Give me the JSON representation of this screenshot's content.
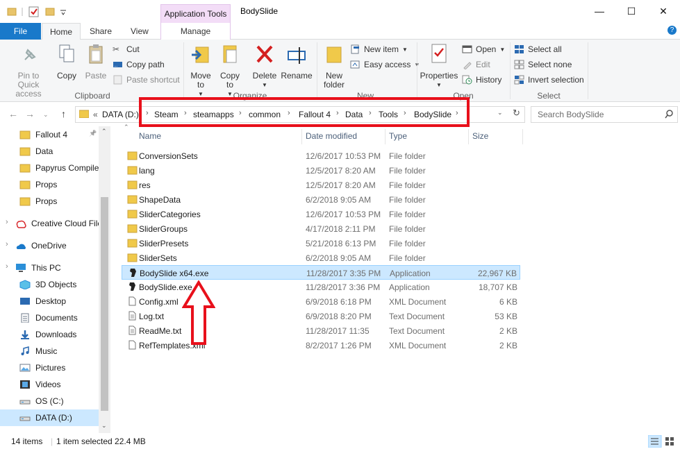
{
  "window": {
    "title": "BodySlide",
    "context_tab": "Application Tools",
    "minimize": "—",
    "maximize": "☐",
    "close": "✕"
  },
  "tabs": {
    "file": "File",
    "home": "Home",
    "share": "Share",
    "view": "View",
    "manage": "Manage"
  },
  "ribbon": {
    "clipboard": {
      "label": "Clipboard",
      "pin": "Pin to Quick access",
      "copy": "Copy",
      "paste": "Paste",
      "cut": "Cut",
      "copy_path": "Copy path",
      "paste_shortcut": "Paste shortcut"
    },
    "organize": {
      "label": "Organize",
      "move_to": "Move to",
      "copy_to": "Copy to",
      "delete": "Delete",
      "rename": "Rename"
    },
    "new": {
      "label": "New",
      "new_folder": "New folder",
      "new_item": "New item",
      "easy_access": "Easy access"
    },
    "open": {
      "label": "Open",
      "properties": "Properties",
      "open": "Open",
      "edit": "Edit",
      "history": "History"
    },
    "select": {
      "label": "Select",
      "select_all": "Select all",
      "select_none": "Select none",
      "invert": "Invert selection"
    }
  },
  "address": {
    "prefix": "«",
    "crumbs": [
      "DATA (D:)",
      "Steam",
      "steamapps",
      "common",
      "Fallout 4",
      "Data",
      "Tools",
      "BodySlide"
    ]
  },
  "search": {
    "placeholder": "Search BodySlide"
  },
  "nav_pane": {
    "items": [
      {
        "label": "Fallout 4",
        "icon": "folder-icon"
      },
      {
        "label": "Data",
        "icon": "folder-icon"
      },
      {
        "label": "Papyrus Compiler",
        "icon": "folder-icon"
      },
      {
        "label": "Props",
        "icon": "folder-icon"
      },
      {
        "label": "Props",
        "icon": "folder-icon"
      },
      {
        "label": "Creative Cloud Files",
        "icon": "creative-cloud-icon"
      },
      {
        "label": "OneDrive",
        "icon": "onedrive-icon"
      },
      {
        "label": "This PC",
        "icon": "computer-icon"
      },
      {
        "label": "3D Objects",
        "icon": "cube-icon"
      },
      {
        "label": "Desktop",
        "icon": "desktop-icon"
      },
      {
        "label": "Documents",
        "icon": "documents-icon"
      },
      {
        "label": "Downloads",
        "icon": "download-icon"
      },
      {
        "label": "Music",
        "icon": "music-icon"
      },
      {
        "label": "Pictures",
        "icon": "pictures-icon"
      },
      {
        "label": "Videos",
        "icon": "videos-icon"
      },
      {
        "label": "OS (C:)",
        "icon": "drive-icon"
      },
      {
        "label": "DATA (D:)",
        "icon": "drive-icon"
      }
    ]
  },
  "columns": {
    "name": "Name",
    "date": "Date modified",
    "type": "Type",
    "size": "Size"
  },
  "files": [
    {
      "name": "ConversionSets",
      "date": "12/6/2017 10:53 PM",
      "type": "File folder",
      "size": "",
      "icon": "folder-icon"
    },
    {
      "name": "lang",
      "date": "12/5/2017 8:20 AM",
      "type": "File folder",
      "size": "",
      "icon": "folder-icon"
    },
    {
      "name": "res",
      "date": "12/5/2017 8:20 AM",
      "type": "File folder",
      "size": "",
      "icon": "folder-icon"
    },
    {
      "name": "ShapeData",
      "date": "6/2/2018 9:05 AM",
      "type": "File folder",
      "size": "",
      "icon": "folder-icon"
    },
    {
      "name": "SliderCategories",
      "date": "12/6/2017 10:53 PM",
      "type": "File folder",
      "size": "",
      "icon": "folder-icon"
    },
    {
      "name": "SliderGroups",
      "date": "4/17/2018 2:11 PM",
      "type": "File folder",
      "size": "",
      "icon": "folder-icon"
    },
    {
      "name": "SliderPresets",
      "date": "5/21/2018 6:13 PM",
      "type": "File folder",
      "size": "",
      "icon": "folder-icon"
    },
    {
      "name": "SliderSets",
      "date": "6/2/2018 9:05 AM",
      "type": "File folder",
      "size": "",
      "icon": "folder-icon"
    },
    {
      "name": "BodySlide x64.exe",
      "date": "11/28/2017 3:35 PM",
      "type": "Application",
      "size": "22,967 KB",
      "icon": "bodyslide-app-icon",
      "selected": true
    },
    {
      "name": "BodySlide.exe",
      "date": "11/28/2017 3:36 PM",
      "type": "Application",
      "size": "18,707 KB",
      "icon": "bodyslide-app-icon"
    },
    {
      "name": "Config.xml",
      "date": "6/9/2018 6:18 PM",
      "type": "XML Document",
      "size": "6 KB",
      "icon": "document-icon"
    },
    {
      "name": "Log.txt",
      "date": "6/9/2018 8:20 PM",
      "type": "Text Document",
      "size": "53 KB",
      "icon": "text-document-icon"
    },
    {
      "name": "ReadMe.txt",
      "date": "11/28/2017 11:35",
      "type": "Text Document",
      "size": "2 KB",
      "icon": "text-document-icon"
    },
    {
      "name": "RefTemplates.xml",
      "date": "8/2/2017 1:26 PM",
      "type": "XML Document",
      "size": "2 KB",
      "icon": "document-icon"
    }
  ],
  "status": {
    "count": "14 items",
    "selection": "1 item selected  22.4 MB"
  },
  "colors": {
    "accent": "#1979ca",
    "selection": "#cce8ff",
    "annotation_red": "#e8101b",
    "context_tab": "#f3ddf7"
  }
}
